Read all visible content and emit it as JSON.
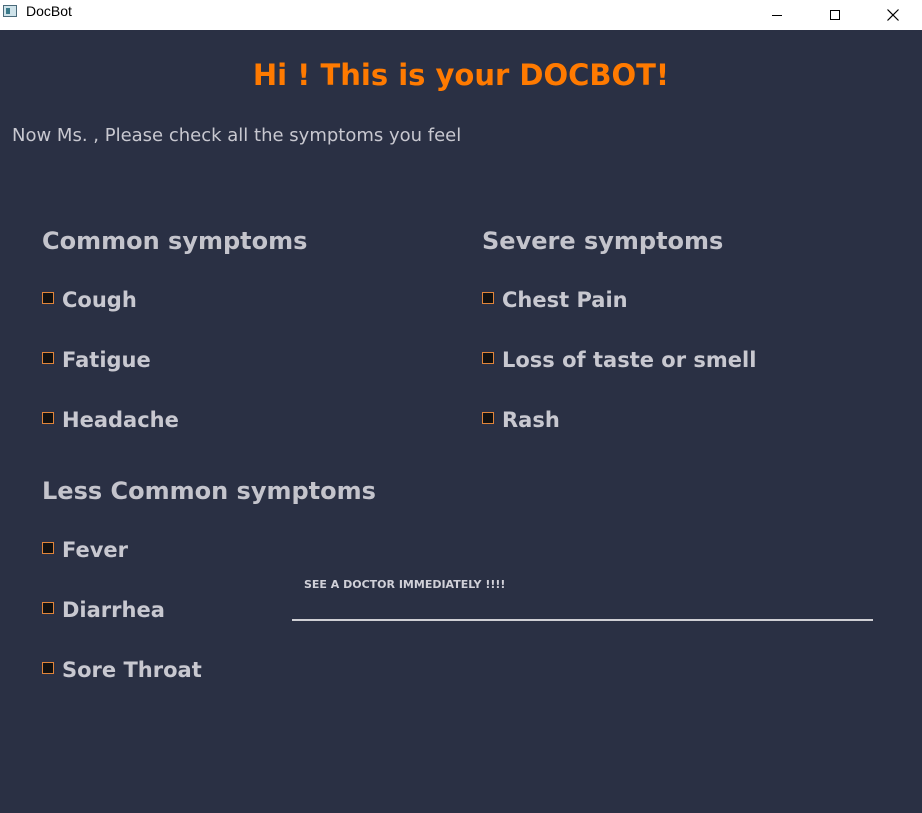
{
  "window": {
    "title": "DocBot"
  },
  "header": {
    "greeting": "Hi ! This is your DOCBOT!"
  },
  "prompt": "Now Ms. , Please check all the symptoms you feel",
  "sections": {
    "common": {
      "title": "Common symptoms",
      "items": [
        "Cough",
        "Fatigue",
        "Headache"
      ]
    },
    "severe": {
      "title": "Severe symptoms",
      "items": [
        "Chest Pain",
        "Loss of taste or smell",
        "Rash"
      ]
    },
    "less_common": {
      "title": "Less Common symptoms",
      "items": [
        "Fever",
        "Diarrhea",
        "Sore Throat"
      ]
    }
  },
  "result": {
    "message": "SEE A DOCTOR IMMEDIATELY !!!!"
  },
  "colors": {
    "background": "#2a3044",
    "accent": "#ff7a00",
    "text": "#c8c8d0"
  }
}
